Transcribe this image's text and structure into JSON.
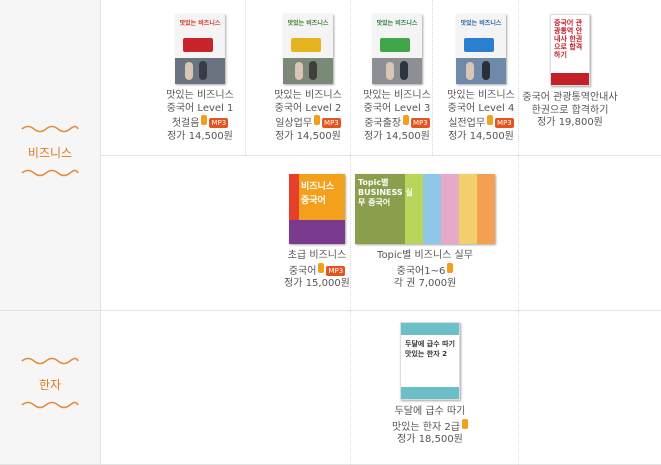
{
  "categories": [
    {
      "label": "비즈니스"
    },
    {
      "label": "한자"
    }
  ],
  "badges": {
    "mp3": "MP3"
  },
  "books_row1": [
    {
      "cover_title": "맛있는 비즈니스",
      "cover_sub": "중국어",
      "cover_level": "Level 1",
      "line1": "맛있는 비즈니스",
      "line2": "중국어 Level 1",
      "line3": "첫걸음",
      "price": "정가 14,500원"
    },
    {
      "cover_title": "맛있는 비즈니스",
      "cover_sub": "중국어",
      "cover_level": "Level 2",
      "line1": "맛있는 비즈니스",
      "line2": "중국어 Level 2",
      "line3": "일상업무",
      "price": "정가 14,500원"
    },
    {
      "cover_title": "맛있는 비즈니스",
      "cover_sub": "중국어",
      "cover_level": "Level 3",
      "line1": "맛있는 비즈니스",
      "line2": "중국어 Level 3",
      "line3": "중국출장",
      "price": "정가 14,500원"
    },
    {
      "cover_title": "맛있는 비즈니스",
      "cover_sub": "중국어",
      "cover_level": "Level 4",
      "line1": "맛있는 비즈니스",
      "line2": "중국어 Level 4",
      "line3": "실전업무",
      "price": "정가 14,500원"
    },
    {
      "cover_title": "중국어 관광통역 안내사 한권으로 합격하기",
      "line1": "중국어 관광통역안내사",
      "line2": "한권으로 합격하기",
      "price": "정가 19,800원"
    }
  ],
  "books_row2": [
    {
      "cover_title": "비즈니스 중국어",
      "line1": "초급 비즈니스",
      "line2": "중국어",
      "price": "정가 15,000원"
    },
    {
      "cover_title": "Topic별 BUSINESS 실무 중국어",
      "line1": "Topic별 비즈니스 실무",
      "line2": "중국어1~6",
      "price": "각 권 7,000원"
    }
  ],
  "books_row3": [
    {
      "cover_title": "두달에 급수 따기 맛있는 한자 2",
      "line1": "두달에 급수 따기",
      "line2": "맛있는 한자 2급",
      "price": "정가 18,500원"
    }
  ],
  "colors": {
    "accent": "#e07a1e",
    "book_badge": "#f2a01b",
    "mp3_badge": "#e3541e"
  }
}
